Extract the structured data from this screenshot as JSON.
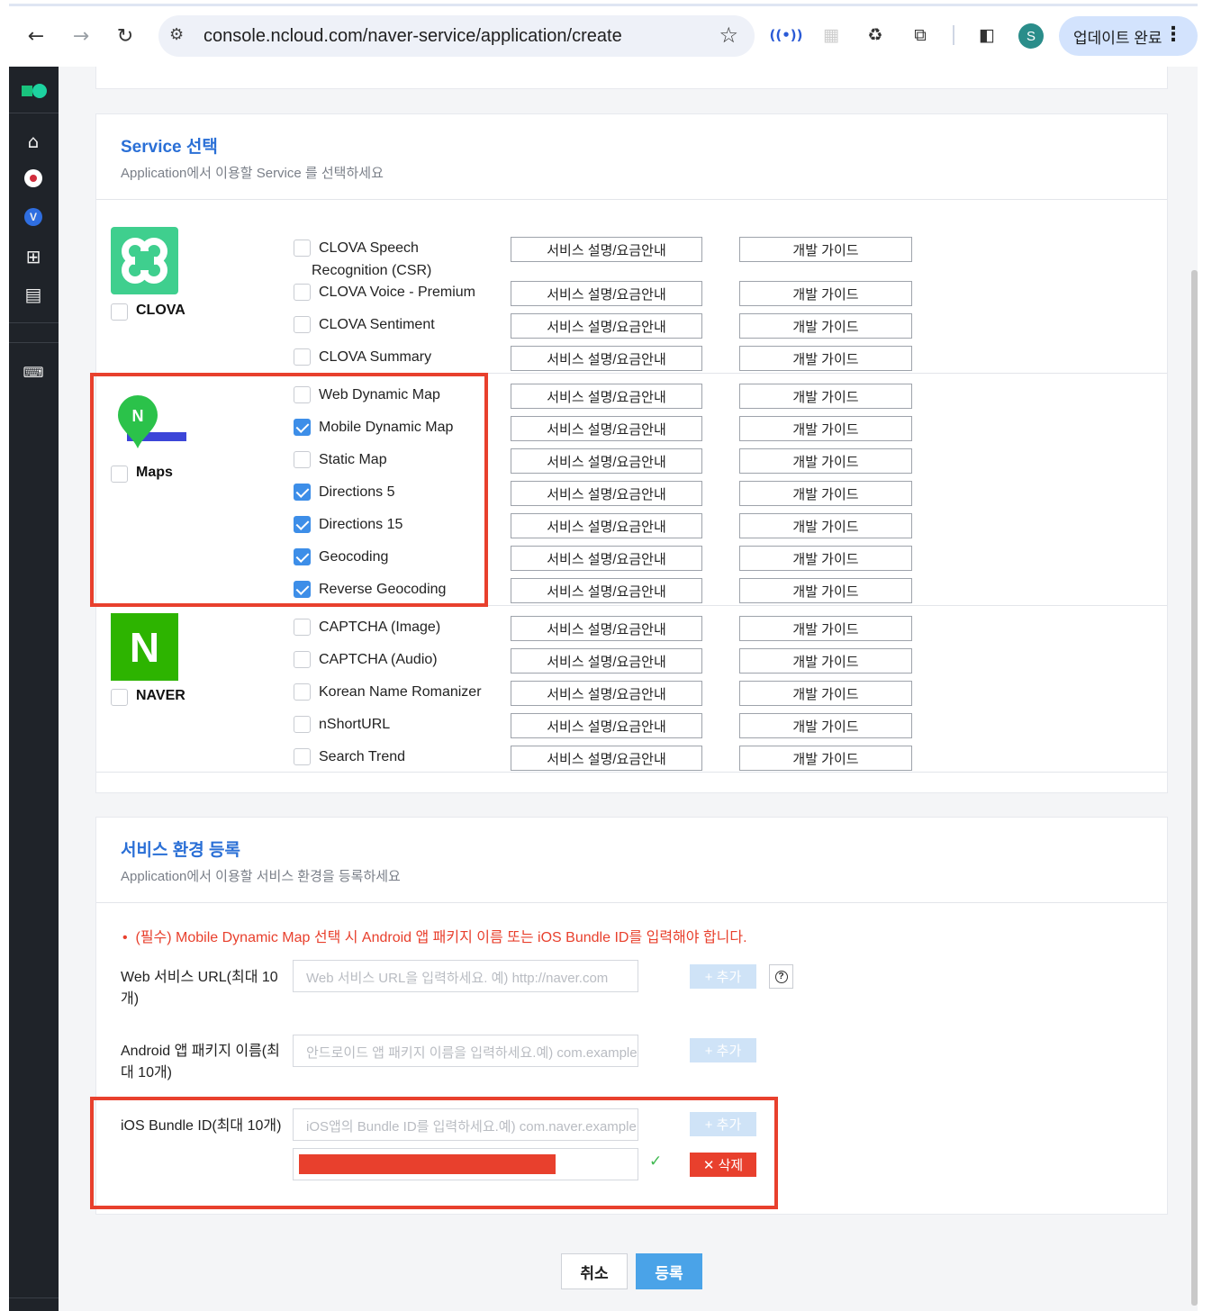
{
  "browser": {
    "url": "console.ncloud.com/naver-service/application/create",
    "profile_initial": "S",
    "update_label": "업데이트 완료"
  },
  "service_section": {
    "title": "Service 선택",
    "subtitle": "Application에서 이용할 Service 를 선택하세요",
    "desc_button_label": "서비스 설명/요금안내",
    "guide_button_label": "개발 가이드",
    "groups": [
      {
        "name": "CLOVA",
        "checked": false,
        "services": [
          {
            "label": "CLOVA Speech\nRecognition (CSR)",
            "checked": false
          },
          {
            "label": "CLOVA Voice - Premium",
            "checked": false
          },
          {
            "label": "CLOVA Sentiment",
            "checked": false
          },
          {
            "label": "CLOVA Summary",
            "checked": false
          }
        ]
      },
      {
        "name": "Maps",
        "checked": false,
        "services": [
          {
            "label": "Web Dynamic Map",
            "checked": false
          },
          {
            "label": "Mobile Dynamic Map",
            "checked": true
          },
          {
            "label": "Static Map",
            "checked": false
          },
          {
            "label": "Directions 5",
            "checked": true
          },
          {
            "label": "Directions 15",
            "checked": true
          },
          {
            "label": "Geocoding",
            "checked": true
          },
          {
            "label": "Reverse Geocoding",
            "checked": true
          }
        ]
      },
      {
        "name": "NAVER",
        "checked": false,
        "services": [
          {
            "label": "CAPTCHA (Image)",
            "checked": false
          },
          {
            "label": "CAPTCHA (Audio)",
            "checked": false
          },
          {
            "label": "Korean Name Romanizer",
            "checked": false
          },
          {
            "label": "nShortURL",
            "checked": false
          },
          {
            "label": "Search Trend",
            "checked": false
          }
        ]
      }
    ]
  },
  "env_section": {
    "title": "서비스 환경 등록",
    "subtitle": "Application에서 이용할 서비스 환경을 등록하세요",
    "notice_bullet": "•",
    "notice": "(필수) Mobile Dynamic Map 선택 시 Android 앱 패키지 이름 또는 iOS Bundle ID를 입력해야 합니다.",
    "web_url": {
      "label": "Web 서비스 URL(최대 10\n개)",
      "placeholder": "Web 서비스 URL을 입력하세요. 예) http://naver.com",
      "add_label": "+ 추가"
    },
    "android": {
      "label": "Android 앱 패키지 이름(최\n대 10개)",
      "placeholder": "안드로이드 앱 패키지 이름을 입력하세요.예) com.example",
      "add_label": "+ 추가"
    },
    "ios": {
      "label": "iOS Bundle ID(최대 10개)",
      "placeholder": "iOS앱의 Bundle ID를 입력하세요.예) com.naver.example",
      "add_label": "+ 추가",
      "delete_label": "✕ 삭제"
    }
  },
  "footer": {
    "cancel_label": "취소",
    "submit_label": "등록"
  },
  "colors": {
    "accent": "#2a6fd6",
    "checkbox_on": "#3d8ee8",
    "highlight_red": "#e8402d",
    "nav_bg": "#1f2329"
  }
}
